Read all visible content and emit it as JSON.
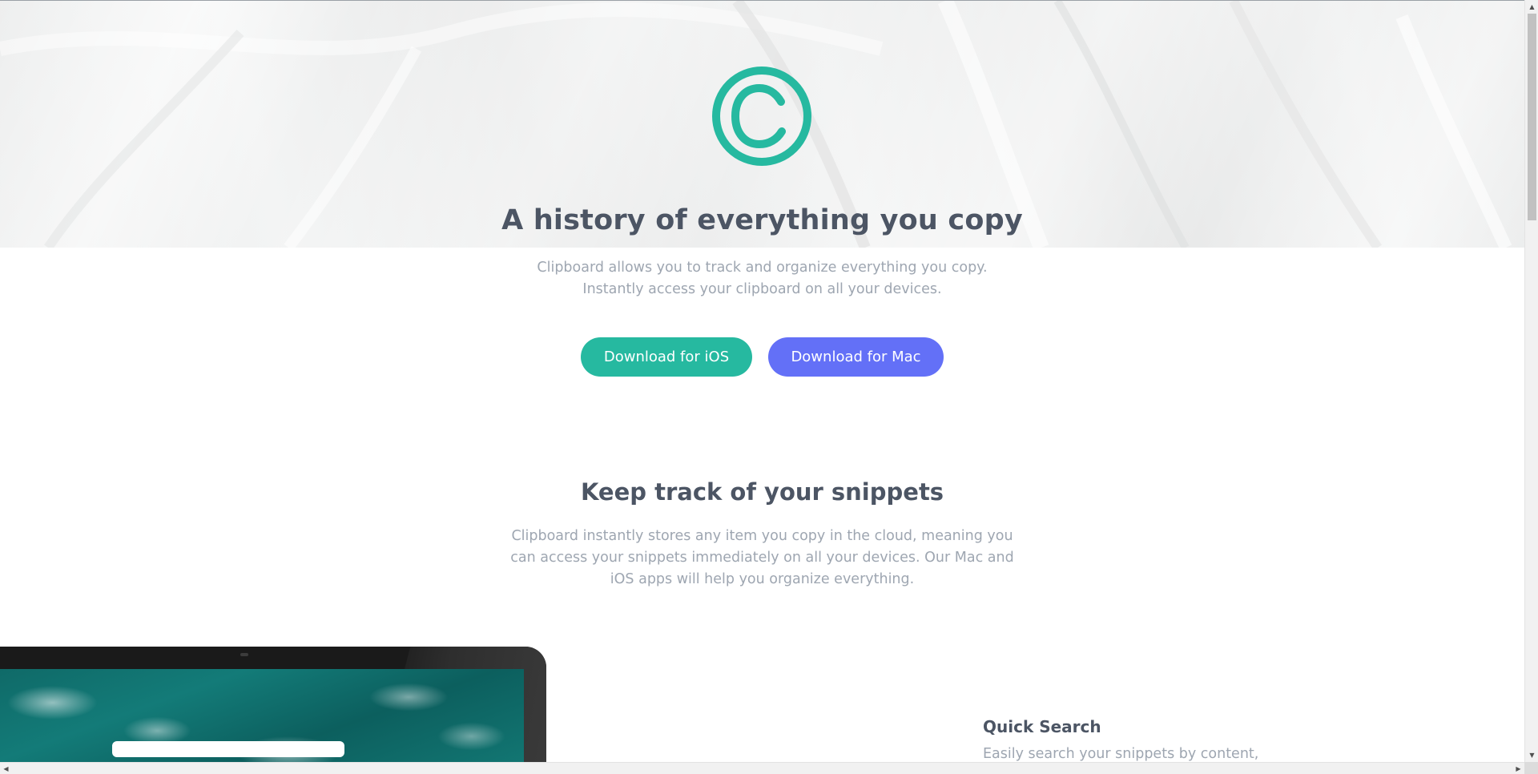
{
  "hero": {
    "title": "A history of everything you copy",
    "description": "Clipboard allows you to track and organize everything you copy. Instantly access your clipboard on all your devices.",
    "buttons": {
      "ios_label": "Download for iOS",
      "mac_label": "Download for Mac"
    }
  },
  "snippets": {
    "title": "Keep track of your snippets",
    "description": "Clipboard instantly stores any item you copy in the cloud, meaning you can access your snippets immediately on all your devices. Our Mac and iOS apps will help you organize everything."
  },
  "features": [
    {
      "title": "Quick Search",
      "description": "Easily search your snippets by content,"
    }
  ],
  "icons": {
    "logo": "copyright-logo-icon",
    "scroll_up": "arrow-up-icon",
    "scroll_down": "arrow-down-icon",
    "scroll_left": "arrow-left-icon",
    "scroll_right": "arrow-right-icon"
  },
  "colors": {
    "accent_teal": "#26b9a0",
    "accent_blue": "#6370f7",
    "heading": "#4c5564",
    "body_text": "#9ea6b1"
  }
}
